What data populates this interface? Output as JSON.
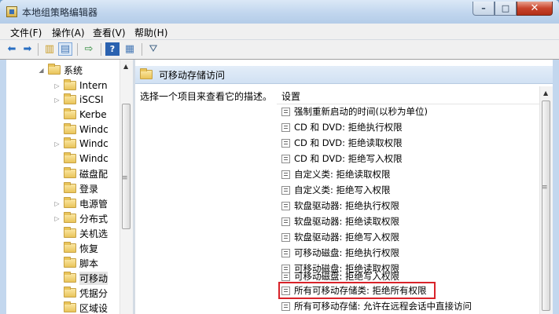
{
  "window": {
    "title": "本地组策略编辑器",
    "minimize": "–",
    "maximize": "□",
    "close": "✕"
  },
  "menu": [
    "文件(F)",
    "操作(A)",
    "查看(V)",
    "帮助(H)"
  ],
  "toolbar": {
    "back": "back-arrow-icon",
    "forward": "forward-arrow-icon"
  },
  "tree": {
    "items": [
      {
        "label": "系统",
        "expander": "◢",
        "selected": false
      },
      {
        "label": "Intern",
        "expander": "▷",
        "selected": false
      },
      {
        "label": "iSCSI",
        "expander": "▷",
        "selected": false
      },
      {
        "label": "Kerbe",
        "expander": "",
        "selected": false
      },
      {
        "label": "Windc",
        "expander": "",
        "selected": false
      },
      {
        "label": "Windc",
        "expander": "▷",
        "selected": false
      },
      {
        "label": "Windc",
        "expander": "",
        "selected": false
      },
      {
        "label": "磁盘配",
        "expander": "",
        "selected": false
      },
      {
        "label": "登录",
        "expander": "",
        "selected": false
      },
      {
        "label": "电源管",
        "expander": "▷",
        "selected": false
      },
      {
        "label": "分布式",
        "expander": "▷",
        "selected": false
      },
      {
        "label": "关机选",
        "expander": "",
        "selected": false
      },
      {
        "label": "恢复",
        "expander": "",
        "selected": false
      },
      {
        "label": "脚本",
        "expander": "",
        "selected": false
      },
      {
        "label": "可移动",
        "expander": "",
        "selected": true
      },
      {
        "label": "凭据分",
        "expander": "",
        "selected": false
      },
      {
        "label": "区域设",
        "expander": "",
        "selected": false
      }
    ]
  },
  "right": {
    "header": "可移动存储访问",
    "description": "选择一个项目来查看它的描述。",
    "column_header": "设置",
    "rows": [
      "强制重新启动的时间(以秒为单位)",
      "CD 和 DVD: 拒绝执行权限",
      "CD 和 DVD: 拒绝读取权限",
      "CD 和 DVD: 拒绝写入权限",
      "自定义类: 拒绝读取权限",
      "自定义类: 拒绝写入权限",
      "软盘驱动器: 拒绝执行权限",
      "软盘驱动器: 拒绝读取权限",
      "软盘驱动器: 拒绝写入权限",
      "可移动磁盘: 拒绝执行权限",
      "可移动磁盘: 拒绝读取权限",
      "可移动磁盘: 拒绝写入权限",
      "所有可移动存储类: 拒绝所有权限",
      "所有可移动存储: 允许在远程会话中直接访问"
    ]
  },
  "colors": {
    "highlight": "#d8232a",
    "header_bg": "#d1e1f3"
  }
}
